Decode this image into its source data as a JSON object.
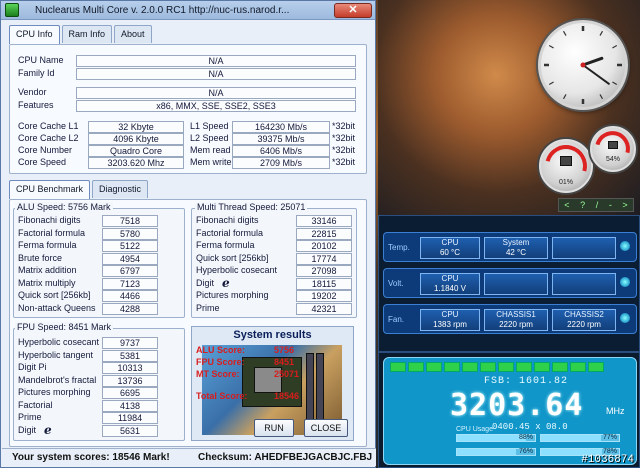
{
  "window": {
    "title": "Nuclearus Multi Core   v. 2.0.0    RC1    http://nuc-rus.narod.r...",
    "close_glyph": "✕"
  },
  "main_tabs": [
    "CPU Info",
    "Ram Info",
    "About"
  ],
  "cpu_info": {
    "fields": [
      {
        "label": "CPU Name",
        "value": "N/A"
      },
      {
        "label": "Family Id",
        "value": "N/A"
      },
      {
        "label": "Vendor",
        "value": "N/A"
      },
      {
        "label": "Features",
        "value": "x86, MMX, SSE, SSE2, SSE3"
      }
    ],
    "left_rows": [
      {
        "label": "Core Cache L1",
        "value": "32 Kbyte"
      },
      {
        "label": "Core Cache L2",
        "value": "4096 Kbyte"
      },
      {
        "label": "Core Number",
        "value": "Quadro Core"
      },
      {
        "label": "Core Speed",
        "value": "3203.620 Mhz"
      }
    ],
    "right_rows": [
      {
        "label": "L1 Speed",
        "value": "164230 Mb/s",
        "unit": "*32bit"
      },
      {
        "label": "L2 Speed",
        "value": "39375 Mb/s",
        "unit": "*32bit"
      },
      {
        "label": "Mem read",
        "value": "6406 Mb/s",
        "unit": "*32bit"
      },
      {
        "label": "Mem write",
        "value": "2709 Mb/s",
        "unit": "*32bit"
      }
    ]
  },
  "bench_tabs": [
    "CPU Benchmark",
    "Diagnostic"
  ],
  "alu": {
    "title": "ALU Speed: 5756 Mark",
    "rows": [
      {
        "label": "Fibonachi digits",
        "value": "7518"
      },
      {
        "label": "Factorial formula",
        "value": "5780"
      },
      {
        "label": "Ferma formula",
        "value": "5122"
      },
      {
        "label": "Brute force",
        "value": "4954"
      },
      {
        "label": "Matrix addition",
        "value": "6797"
      },
      {
        "label": "Matrix multiply",
        "value": "7123"
      },
      {
        "label": "Quick sort [256kb]",
        "value": "4466"
      },
      {
        "label": "Non-attack Queens",
        "value": "4288"
      }
    ]
  },
  "mt": {
    "title": "Multi Thread Speed: 25071",
    "rows": [
      {
        "label": "Fibonachi digits",
        "value": "33146"
      },
      {
        "label": "Factorial formula",
        "value": "22815"
      },
      {
        "label": "Ferma formula",
        "value": "20102"
      },
      {
        "label": "Quick sort [256kb]",
        "value": "17774"
      },
      {
        "label": "Hyperbolic cosecant",
        "value": "27098"
      },
      {
        "label": "Digit",
        "value": "18115",
        "symbol": "e"
      },
      {
        "label": "Pictures morphing",
        "value": "19202"
      },
      {
        "label": "Prime",
        "value": "42321"
      }
    ]
  },
  "fpu": {
    "title": "FPU Speed: 8451 Mark",
    "rows": [
      {
        "label": "Hyperbolic cosecant",
        "value": "9737"
      },
      {
        "label": "Hyperbolic tangent",
        "value": "5381"
      },
      {
        "label": "Digit Pi",
        "value": "10313"
      },
      {
        "label": "Mandelbrot's fractal",
        "value": "13736"
      },
      {
        "label": "Pictures morphing",
        "value": "6695"
      },
      {
        "label": "Factorial",
        "value": "4138"
      },
      {
        "label": "Prime",
        "value": "11984"
      },
      {
        "label": "Digit",
        "value": "5631",
        "symbol": "e"
      }
    ]
  },
  "results": {
    "title": "System results",
    "alu": "ALU Score:",
    "alu_value": "5756",
    "fpu": "FPU Score:",
    "fpu_value": "8451",
    "mt": "MT Score:",
    "mt_value": "25071",
    "total": "Total Score:",
    "total_value": "18546",
    "run_label": "RUN",
    "close_label": "CLOSE"
  },
  "status": {
    "scores": "Your system scores: 18546 Mark!",
    "checksum": "Checksum:  AHEDFBEJGACBJC.FBJ"
  },
  "gadgets": {
    "cpu_gauge": "01%",
    "mem_gauge": "54%",
    "strip": [
      "<",
      "?",
      "/",
      "-",
      ">"
    ],
    "clock": {
      "hour": 2,
      "minute": 21
    }
  },
  "sensors": {
    "temp_label": "Temp.",
    "volt_label": "Volt.",
    "fan_label": "Fan.",
    "temp": [
      {
        "title": "CPU",
        "value": "60  °C"
      },
      {
        "title": "System",
        "value": "42  °C"
      }
    ],
    "volt": [
      {
        "title": "CPU",
        "value": "1.1840  V"
      }
    ],
    "fan": [
      {
        "title": "CPU",
        "value": "1383  rpm"
      },
      {
        "title": "CHASSIS1",
        "value": "2220  rpm"
      },
      {
        "title": "CHASSIS2",
        "value": "2220  rpm"
      }
    ]
  },
  "freq": {
    "fsb": "FSB: 1601.82",
    "mhz": "3203.64",
    "unit": "MHz",
    "mult": "0400.45  x  08.0",
    "cpu_usage_label": "CPU Usage",
    "usage": [
      {
        "label": "88%",
        "fraction": 0.88
      },
      {
        "label": "77%",
        "fraction": 0.77
      },
      {
        "label": "76%",
        "fraction": 0.76
      },
      {
        "label": "78%",
        "fraction": 0.78
      }
    ]
  },
  "watermark": "#1036874"
}
